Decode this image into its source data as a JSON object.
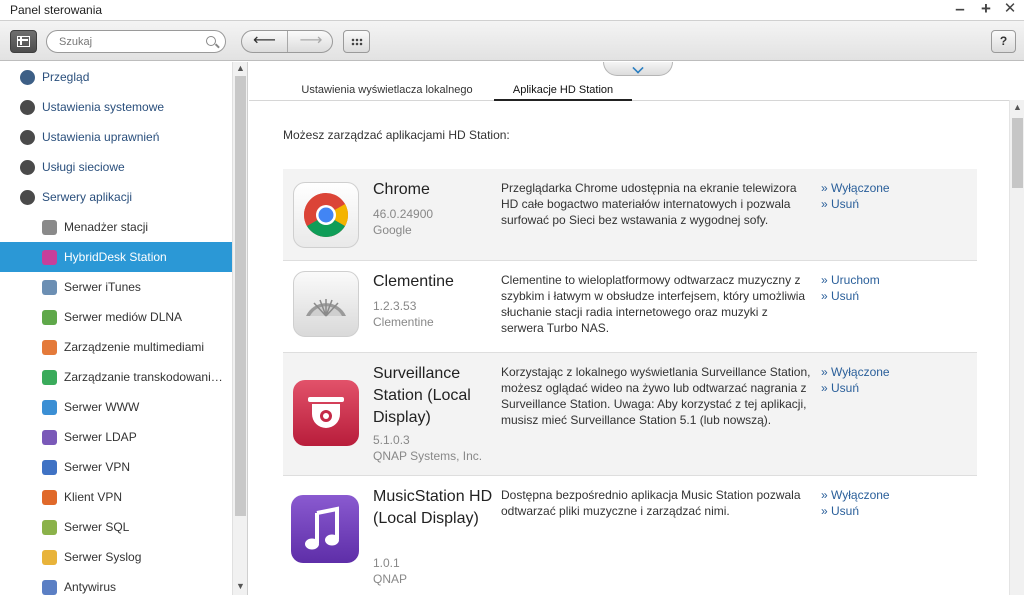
{
  "window": {
    "title": "Panel sterowania",
    "minimize_glyph": "–",
    "maximize_glyph": "+",
    "close_glyph": "✕"
  },
  "toolbar": {
    "search_placeholder": "Szukaj",
    "back_glyph": "⟵",
    "forward_glyph": "⟶",
    "help_label": "?"
  },
  "sidebar": {
    "items": [
      {
        "label": "Przegląd",
        "level": "top",
        "icon": "overview-icon",
        "color": "#3d5f86"
      },
      {
        "label": "Ustawienia systemowe",
        "level": "top",
        "icon": "gear-icon",
        "color": "#4a4a4a"
      },
      {
        "label": "Ustawienia uprawnień",
        "level": "top",
        "icon": "user-icon",
        "color": "#4a4a4a"
      },
      {
        "label": "Usługi sieciowe",
        "level": "top",
        "icon": "globe-icon",
        "color": "#4a4a4a"
      },
      {
        "label": "Serwery aplikacji",
        "level": "top",
        "icon": "server-icon",
        "color": "#4a4a4a"
      },
      {
        "label": "Menadżer stacji",
        "level": "sub",
        "icon": "station-manager-icon",
        "color": "#8a8a8a"
      },
      {
        "label": "HybridDesk Station",
        "level": "sub",
        "icon": "hybriddesk-icon",
        "color": "#c63f9b",
        "selected": true
      },
      {
        "label": "Serwer iTunes",
        "level": "sub",
        "icon": "itunes-icon",
        "color": "#6c8fb3"
      },
      {
        "label": "Serwer mediów DLNA",
        "level": "sub",
        "icon": "dlna-icon",
        "color": "#5fa84a"
      },
      {
        "label": "Zarządzenie multimediami",
        "level": "sub",
        "icon": "multimedia-icon",
        "color": "#e47a3a"
      },
      {
        "label": "Zarządzanie transkodowaniem",
        "level": "sub",
        "icon": "transcode-icon",
        "color": "#3aab5b"
      },
      {
        "label": "Serwer WWW",
        "level": "sub",
        "icon": "www-icon",
        "color": "#3b8fd4"
      },
      {
        "label": "Serwer LDAP",
        "level": "sub",
        "icon": "ldap-icon",
        "color": "#7a59b8"
      },
      {
        "label": "Serwer VPN",
        "level": "sub",
        "icon": "vpn-server-icon",
        "color": "#3f72c4"
      },
      {
        "label": "Klient VPN",
        "level": "sub",
        "icon": "vpn-client-icon",
        "color": "#e0692a"
      },
      {
        "label": "Serwer SQL",
        "level": "sub",
        "icon": "sql-icon",
        "color": "#8bb24a"
      },
      {
        "label": "Serwer Syslog",
        "level": "sub",
        "icon": "syslog-icon",
        "color": "#e8b33a"
      },
      {
        "label": "Antywirus",
        "level": "sub",
        "icon": "antivirus-icon",
        "color": "#5b7fc4"
      }
    ]
  },
  "main": {
    "tabs": [
      {
        "label": "Ustawienia wyświetlacza lokalnego",
        "active": false
      },
      {
        "label": "Aplikacje HD Station",
        "active": true
      }
    ],
    "intro": "Możesz zarządzać aplikacjami HD Station:",
    "apps": [
      {
        "name": "Chrome",
        "version": "46.0.24900",
        "publisher": "Google",
        "description": "Przeglądarka Chrome udostępnia na ekranie telewizora HD całe bogactwo materiałów internatowych i pozwala surfować po Sieci bez wstawania z wygodnej sofy.",
        "action1": "» Wyłączone",
        "action2": "» Usuń",
        "icon": "chrome-icon"
      },
      {
        "name": "Clementine",
        "version": "1.2.3.53",
        "publisher": "Clementine",
        "description": "Clementine to wieloplatformowy odtwarzacz muzyczny z szybkim i łatwym w obsłudze interfejsem, który umożliwia słuchanie stacji radia internetowego oraz muzyki z serwera Turbo NAS.",
        "action1": "» Uruchom",
        "action2": "» Usuń",
        "icon": "clementine-icon"
      },
      {
        "name": "Surveillance Station (Local Display)",
        "version": "5.1.0.3",
        "publisher": "QNAP Systems, Inc.",
        "description": "Korzystając z lokalnego wyświetlania Surveillance Station, możesz oglądać wideo na żywo lub odtwarzać nagrania z Surveillance Station. Uwaga: Aby korzystać z tej aplikacji, musisz mieć Surveillance Station 5.1 (lub nowszą).",
        "action1": "» Wyłączone",
        "action2": "» Usuń",
        "icon": "surveillance-icon"
      },
      {
        "name": "MusicStation HD (Local Display)",
        "version": "1.0.1",
        "publisher": "QNAP",
        "description": "Dostępna bezpośrednio aplikacja Music Station pozwala odtwarzać pliki muzyczne i zarządzać nimi.",
        "action1": "» Wyłączone",
        "action2": "» Usuń",
        "icon": "music-station-icon"
      }
    ]
  }
}
